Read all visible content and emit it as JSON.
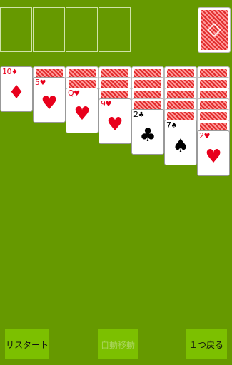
{
  "foundations": [
    "",
    "",
    "",
    ""
  ],
  "tableau": [
    {
      "hidden": 0,
      "top": {
        "rank": "10",
        "suit": "♦",
        "color": "red"
      }
    },
    {
      "hidden": 1,
      "top": {
        "rank": "5",
        "suit": "♥",
        "color": "red"
      }
    },
    {
      "hidden": 2,
      "top": {
        "rank": "Q",
        "suit": "♥",
        "color": "red"
      }
    },
    {
      "hidden": 3,
      "top": {
        "rank": "9",
        "suit": "♥",
        "color": "red"
      }
    },
    {
      "hidden": 4,
      "top": {
        "rank": "2",
        "suit": "♣",
        "color": "black"
      }
    },
    {
      "hidden": 5,
      "top": {
        "rank": "7",
        "suit": "♠",
        "color": "black"
      }
    },
    {
      "hidden": 6,
      "top": {
        "rank": "2",
        "suit": "♥",
        "color": "red"
      }
    }
  ],
  "buttons": {
    "restart": "リスタート",
    "auto_move": "自動移動",
    "undo": "１つ戻る"
  },
  "colors": {
    "felt": "#669900",
    "button": "#7cc000",
    "red_suit": "#e8001c"
  }
}
